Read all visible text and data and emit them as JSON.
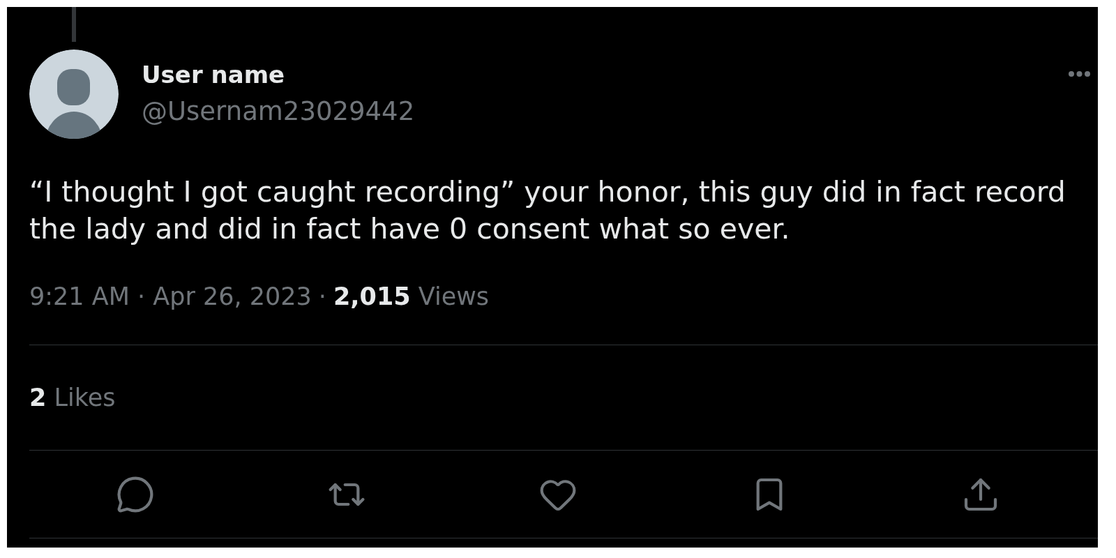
{
  "tweet": {
    "in_thread": true,
    "author": {
      "name": "User name",
      "handle": "@Usernam23029442"
    },
    "text": "“I thought I got caught recording” your honor, this guy did in fact record the lady and did in fact have 0 consent what so ever.",
    "timestamp": "9:21 AM · Apr 26, 2023",
    "separator": "·",
    "views": "**2,015** Views",
    "likes": "**2** Likes"
  },
  "actions": [
    {
      "kind": "reply",
      "active": false
    },
    {
      "kind": "retweet",
      "active": false
    },
    {
      "kind": "like",
      "active": false
    },
    {
      "kind": "bookmark",
      "active": false
    },
    {
      "kind": "share",
      "active": false
    }
  ]
}
